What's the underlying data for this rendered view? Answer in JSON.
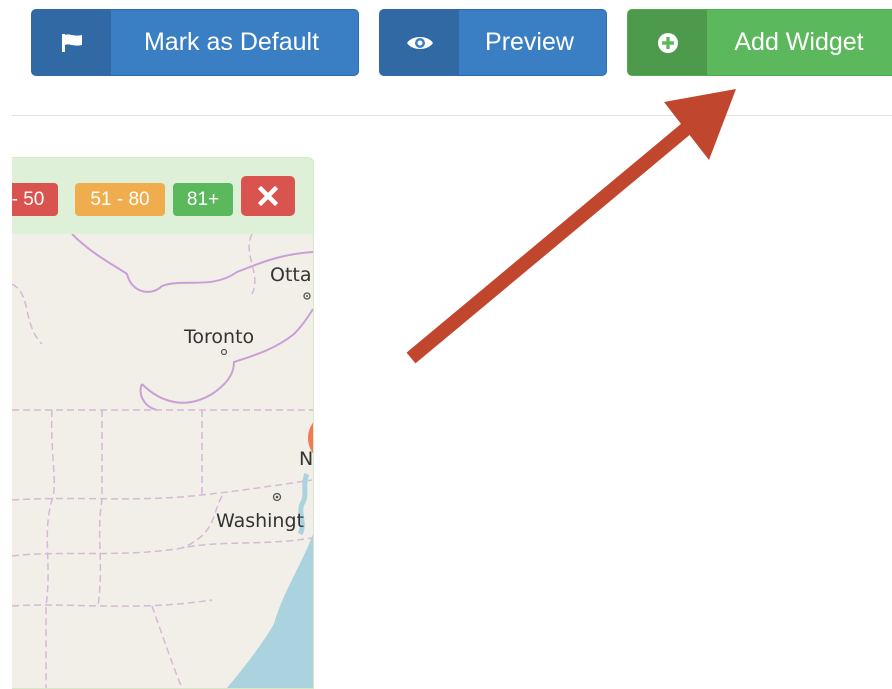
{
  "toolbar": {
    "mark_default": {
      "label": "Mark as Default",
      "icon": "flag-icon"
    },
    "preview": {
      "label": "Preview",
      "icon": "eye-icon"
    },
    "add_widget": {
      "label": "Add Widget",
      "icon": "plus-circle-icon"
    }
  },
  "widget": {
    "legend": {
      "low": "- 50",
      "mid": "51 - 80",
      "high": "81+"
    },
    "close_icon": "close-icon",
    "map": {
      "cities": {
        "ottawa": "Otta",
        "toronto": "Toronto",
        "washington": "Washingt",
        "n": "N"
      }
    }
  },
  "colors": {
    "primary": "#3a7ec3",
    "success": "#5cb85c",
    "danger": "#d9534f",
    "warning": "#f0ad4e",
    "arrow": "#c0462d"
  }
}
